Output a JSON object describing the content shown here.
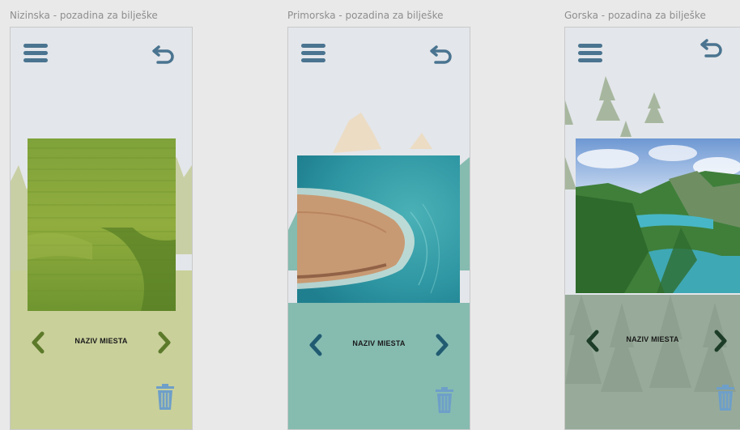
{
  "frames": [
    {
      "title": "Nizinska - pozadina za bilješke",
      "place_label": "NAZIV MIESTA",
      "icons": {
        "menu": "hamburger-menu-icon",
        "back": "undo-back-icon",
        "prev": "chevron-left-icon",
        "next": "chevron-right-icon",
        "delete": "trash-icon"
      },
      "colors": {
        "accent": "#4a7490",
        "chevron": "#5c7a2a",
        "bottom": "#c9d09a",
        "trash": "#6e9fc9"
      }
    },
    {
      "title": "Primorska - pozadina za bilješke",
      "place_label": "NAZIV MIESTA",
      "icons": {
        "menu": "hamburger-menu-icon",
        "back": "undo-back-icon",
        "prev": "chevron-left-icon",
        "next": "chevron-right-icon",
        "delete": "trash-icon"
      },
      "colors": {
        "accent": "#4a7490",
        "chevron": "#215b72",
        "bottom": "#86bbb0",
        "trash": "#6e9fc9"
      }
    },
    {
      "title": "Gorska - pozadina za bilješke",
      "place_label": "NAZIV MIESTA",
      "icons": {
        "menu": "hamburger-menu-icon",
        "back": "undo-back-icon",
        "prev": "chevron-left-icon",
        "next": "chevron-right-icon",
        "delete": "trash-icon"
      },
      "colors": {
        "accent": "#4a7490",
        "chevron": "#1d3d28",
        "bottom": "#98ab9a",
        "trash": "#6e9fc9"
      }
    }
  ]
}
